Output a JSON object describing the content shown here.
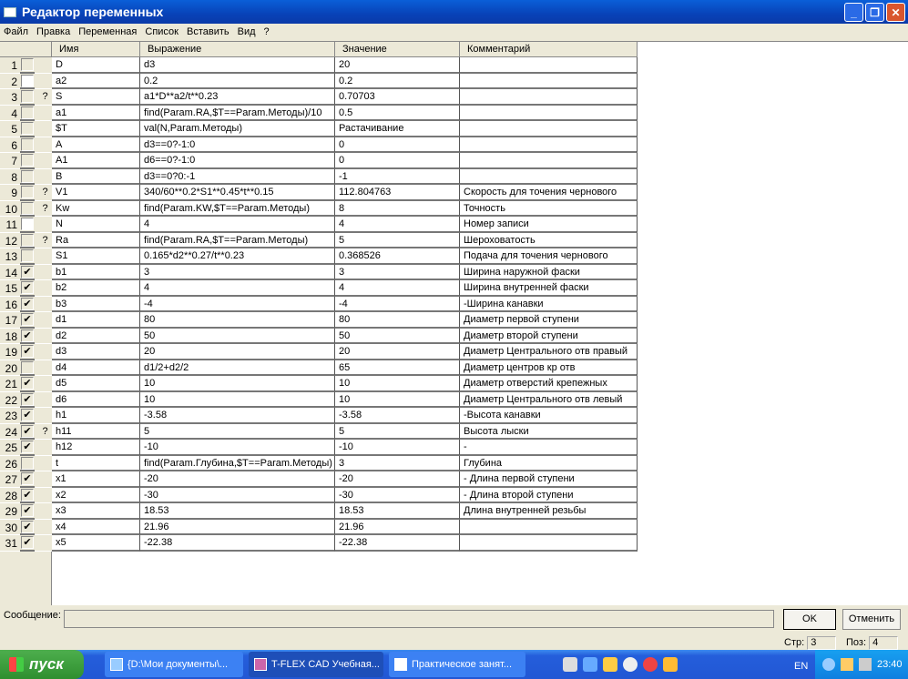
{
  "window": {
    "title": "Редактор переменных"
  },
  "menu": [
    "Файл",
    "Правка",
    "Переменная",
    "Список",
    "Вставить",
    "Вид",
    "?"
  ],
  "columns": [
    "Имя",
    "Выражение",
    "Значение",
    "Комментарий"
  ],
  "rows": [
    {
      "n": "1",
      "chk": "",
      "q": "",
      "name": "D",
      "expr": "d3",
      "val": "20",
      "com": ""
    },
    {
      "n": "2",
      "chk": "white",
      "q": "",
      "name": "a2",
      "expr": "0.2",
      "val": "0.2",
      "com": ""
    },
    {
      "n": "3",
      "chk": "",
      "q": "?",
      "name": "S",
      "expr": "a1*D**a2/t**0.23",
      "val": "0.70703",
      "com": ""
    },
    {
      "n": "4",
      "chk": "",
      "q": "",
      "name": "a1",
      "expr": "find(Param.RA,$T==Param.Методы)/10",
      "val": "0.5",
      "com": ""
    },
    {
      "n": "5",
      "chk": "",
      "q": "",
      "name": "$T",
      "expr": "val(N,Param.Методы)",
      "val": "Растачивание",
      "com": ""
    },
    {
      "n": "6",
      "chk": "",
      "q": "",
      "name": "A",
      "expr": "d3==0?-1:0",
      "val": "0",
      "com": ""
    },
    {
      "n": "7",
      "chk": "",
      "q": "",
      "name": "A1",
      "expr": "d6==0?-1:0",
      "val": "0",
      "com": ""
    },
    {
      "n": "8",
      "chk": "",
      "q": "",
      "name": "B",
      "expr": "d3==0?0:-1",
      "val": "-1",
      "com": ""
    },
    {
      "n": "9",
      "chk": "",
      "q": "?",
      "name": "V1",
      "expr": "340/60**0.2*S1**0.45*t**0.15",
      "val": "112.804763",
      "com": "Скорость для точения чернового"
    },
    {
      "n": "10",
      "chk": "",
      "q": "?",
      "name": "Kw",
      "expr": "find(Param.KW,$T==Param.Методы)",
      "val": "8",
      "com": "Точность"
    },
    {
      "n": "11",
      "chk": "white",
      "q": "",
      "name": "N",
      "expr": "4",
      "val": "4",
      "com": "Номер записи"
    },
    {
      "n": "12",
      "chk": "",
      "q": "?",
      "name": "Ra",
      "expr": "find(Param.RA,$T==Param.Методы)",
      "val": "5",
      "com": "Шероховатость"
    },
    {
      "n": "13",
      "chk": "",
      "q": "",
      "name": "S1",
      "expr": "0.165*d2**0.27/t**0.23",
      "val": "0.368526",
      "com": "Подача для точения чернового"
    },
    {
      "n": "14",
      "chk": "checked",
      "q": "",
      "name": "b1",
      "expr": "3",
      "val": "3",
      "com": "Ширина наружной фаски"
    },
    {
      "n": "15",
      "chk": "checked",
      "q": "",
      "name": "b2",
      "expr": "4",
      "val": "4",
      "com": "Ширина внутренней фаски"
    },
    {
      "n": "16",
      "chk": "checked",
      "q": "",
      "name": "b3",
      "expr": "-4",
      "val": "-4",
      "com": "-Ширина канавки"
    },
    {
      "n": "17",
      "chk": "checked",
      "q": "",
      "name": "d1",
      "expr": "80",
      "val": "80",
      "com": "Диаметр первой ступени"
    },
    {
      "n": "18",
      "chk": "checked",
      "q": "",
      "name": "d2",
      "expr": "50",
      "val": "50",
      "com": "Диаметр второй ступени"
    },
    {
      "n": "19",
      "chk": "checked",
      "q": "",
      "name": "d3",
      "expr": "20",
      "val": "20",
      "com": "Диаметр Центрального отв правый"
    },
    {
      "n": "20",
      "chk": "",
      "q": "",
      "name": "d4",
      "expr": "d1/2+d2/2",
      "val": "65",
      "com": "Диаметр центров кр отв"
    },
    {
      "n": "21",
      "chk": "checked",
      "q": "",
      "name": "d5",
      "expr": "10",
      "val": "10",
      "com": "Диаметр отверстий крепежных"
    },
    {
      "n": "22",
      "chk": "checked",
      "q": "",
      "name": "d6",
      "expr": "10",
      "val": "10",
      "com": "Диаметр Центрального отв левый"
    },
    {
      "n": "23",
      "chk": "checked",
      "q": "",
      "name": "h1",
      "expr": "-3.58",
      "val": "-3.58",
      "com": "-Высота канавки"
    },
    {
      "n": "24",
      "chk": "checked",
      "q": "?",
      "name": "h11",
      "expr": "5",
      "val": "5",
      "com": "Высота лыски"
    },
    {
      "n": "25",
      "chk": "checked",
      "q": "",
      "name": "h12",
      "expr": "-10",
      "val": "-10",
      "com": "-"
    },
    {
      "n": "26",
      "chk": "",
      "q": "",
      "name": "t",
      "expr": "find(Param.Глубина,$T==Param.Методы)",
      "val": "3",
      "com": "Глубина"
    },
    {
      "n": "27",
      "chk": "checked",
      "q": "",
      "name": "x1",
      "expr": "-20",
      "val": "-20",
      "com": "- Длина первой ступени"
    },
    {
      "n": "28",
      "chk": "checked",
      "q": "",
      "name": "x2",
      "expr": "-30",
      "val": "-30",
      "com": "- Длина второй ступени"
    },
    {
      "n": "29",
      "chk": "checked",
      "q": "",
      "name": "x3",
      "expr": "18.53",
      "val": "18.53",
      "com": "Длина внутренней резьбы"
    },
    {
      "n": "30",
      "chk": "checked",
      "q": "",
      "name": "x4",
      "expr": "21.96",
      "val": "21.96",
      "com": ""
    },
    {
      "n": "31",
      "chk": "checked",
      "q": "",
      "name": "x5",
      "expr": "-22.38",
      "val": "-22.38",
      "com": ""
    }
  ],
  "footer": {
    "message_label": "Сообщение:",
    "message": "",
    "ok": "OK",
    "cancel": "Отменить",
    "line_label": "Стр:",
    "line": "3",
    "pos_label": "Поз:",
    "pos": "4"
  },
  "taskbar": {
    "start": "пуск",
    "tasks": [
      "{D:\\Мои документы\\...",
      "T-FLEX CAD Учебная...",
      "Практическое занят..."
    ],
    "lang": "EN",
    "clock": "23:40"
  }
}
